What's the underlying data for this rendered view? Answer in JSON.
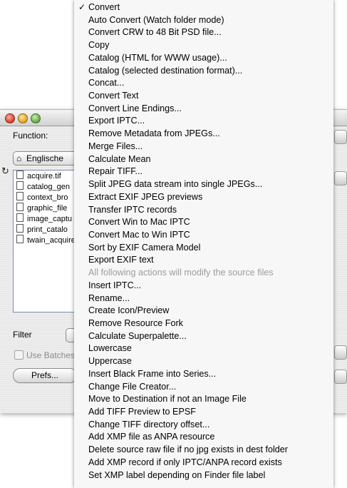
{
  "window": {
    "function_label": "Function:",
    "source_folder": "Englische",
    "files": [
      "acquire.tif",
      "catalog_gen",
      "context_bro",
      "graphic_file",
      "image_captu",
      "print_catalo",
      "twain_acquire"
    ],
    "filter_label": "Filter",
    "use_batches_label": "Use Batches",
    "prefs_label": "Prefs..."
  },
  "menu": {
    "checkmark": "✓",
    "items": [
      {
        "label": "Convert",
        "checked": true,
        "disabled": false
      },
      {
        "label": "Auto Convert (Watch folder mode)",
        "checked": false,
        "disabled": false
      },
      {
        "label": "Convert CRW to 48 Bit PSD file...",
        "checked": false,
        "disabled": false
      },
      {
        "label": "Copy",
        "checked": false,
        "disabled": false
      },
      {
        "label": "Catalog (HTML for WWW usage)...",
        "checked": false,
        "disabled": false
      },
      {
        "label": "Catalog (selected destination format)...",
        "checked": false,
        "disabled": false
      },
      {
        "label": "Concat...",
        "checked": false,
        "disabled": false
      },
      {
        "label": "Convert Text",
        "checked": false,
        "disabled": false
      },
      {
        "label": "Convert Line Endings...",
        "checked": false,
        "disabled": false
      },
      {
        "label": "Export IPTC...",
        "checked": false,
        "disabled": false
      },
      {
        "label": "Remove Metadata from JPEGs...",
        "checked": false,
        "disabled": false
      },
      {
        "label": "Merge Files...",
        "checked": false,
        "disabled": false
      },
      {
        "label": "Calculate Mean",
        "checked": false,
        "disabled": false
      },
      {
        "label": "Repair TIFF...",
        "checked": false,
        "disabled": false
      },
      {
        "label": "Split JPEG data stream into single JPEGs...",
        "checked": false,
        "disabled": false
      },
      {
        "label": "Extract EXIF JPEG previews",
        "checked": false,
        "disabled": false
      },
      {
        "label": "Transfer IPTC records",
        "checked": false,
        "disabled": false
      },
      {
        "label": "Convert Win to Mac IPTC",
        "checked": false,
        "disabled": false
      },
      {
        "label": "Convert Mac to Win IPTC",
        "checked": false,
        "disabled": false
      },
      {
        "label": "Sort by EXIF Camera Model",
        "checked": false,
        "disabled": false
      },
      {
        "label": "Export EXIF text",
        "checked": false,
        "disabled": false
      },
      {
        "label": "All following actions will modify the source files",
        "checked": false,
        "disabled": true
      },
      {
        "label": "Insert IPTC...",
        "checked": false,
        "disabled": false
      },
      {
        "label": "Rename...",
        "checked": false,
        "disabled": false
      },
      {
        "label": "Create Icon/Preview",
        "checked": false,
        "disabled": false
      },
      {
        "label": "Remove Resource Fork",
        "checked": false,
        "disabled": false
      },
      {
        "label": "Calculate Superpalette...",
        "checked": false,
        "disabled": false
      },
      {
        "label": "Lowercase",
        "checked": false,
        "disabled": false
      },
      {
        "label": "Uppercase",
        "checked": false,
        "disabled": false
      },
      {
        "label": "Insert Black Frame into Series...",
        "checked": false,
        "disabled": false
      },
      {
        "label": "Change File Creator...",
        "checked": false,
        "disabled": false
      },
      {
        "label": "Move to Destination if not an Image File",
        "checked": false,
        "disabled": false
      },
      {
        "label": "Add TIFF Preview to EPSF",
        "checked": false,
        "disabled": false
      },
      {
        "label": "Change TIFF directory offset...",
        "checked": false,
        "disabled": false
      },
      {
        "label": "Add XMP file as ANPA resource",
        "checked": false,
        "disabled": false
      },
      {
        "label": "Delete source raw file if no jpg exists in dest folder",
        "checked": false,
        "disabled": false
      },
      {
        "label": "Add XMP record if only IPTC/ANPA record exists",
        "checked": false,
        "disabled": false
      },
      {
        "label": "Set XMP label depending on Finder file label",
        "checked": false,
        "disabled": false
      }
    ]
  },
  "colors": {
    "menu_background": "#f7f7f7",
    "disabled_text": "#9d9d9d",
    "list_border": "#7b8fb5"
  }
}
